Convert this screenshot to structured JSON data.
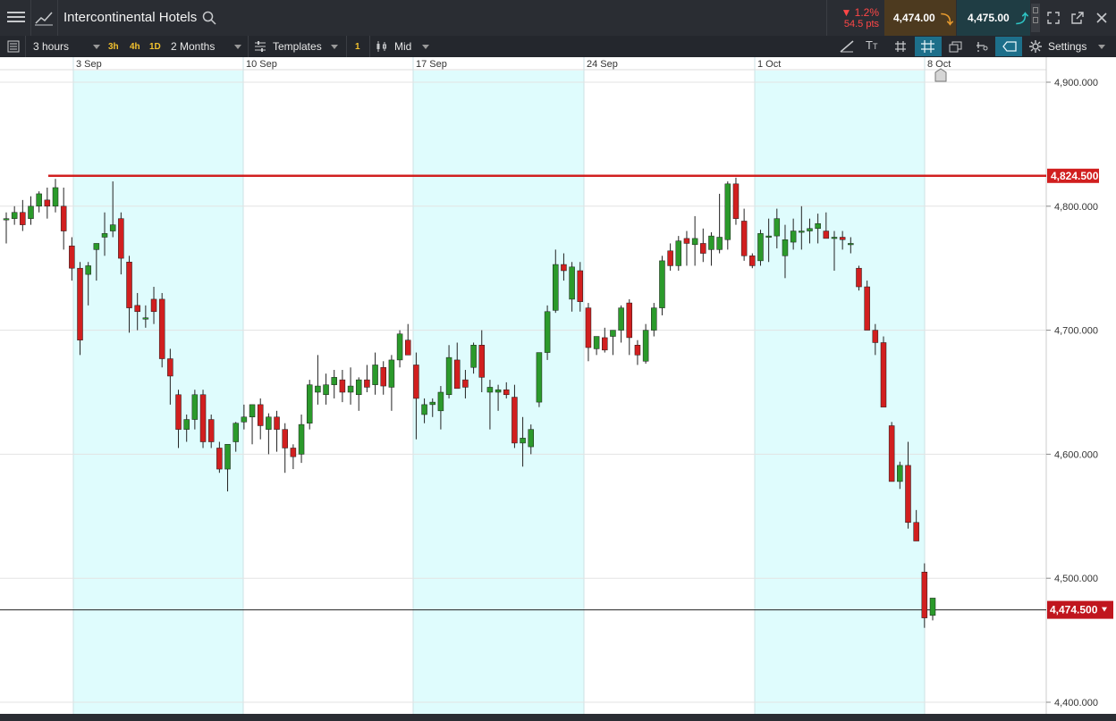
{
  "header": {
    "instrument": "Intercontinental Hotels",
    "change_percent": "▼ 1.2%",
    "change_points": "54.5 pts",
    "sell_price": "4,474.00",
    "buy_price": "4,475.00"
  },
  "toolbar": {
    "interval": "3 hours",
    "quick_intervals": [
      "3h",
      "4h",
      "1D"
    ],
    "range": "2 Months",
    "templates_label": "Templates",
    "count_badge": "1",
    "price_type": "Mid",
    "settings_label": "Settings"
  },
  "colors": {
    "up": "#2b9a2b",
    "down": "#d11f1f",
    "resistance": "#d11f1f",
    "current_price_bg": "#c0161e",
    "weekend_shade": "#dffcfd"
  },
  "chart_data": {
    "type": "candlestick",
    "x_labels": [
      "3 Sep",
      "10 Sep",
      "17 Sep",
      "24 Sep",
      "1 Oct",
      "8 Oct"
    ],
    "y_ticks": [
      "4,900.000",
      "4,800.000",
      "4,700.000",
      "4,600.000",
      "4,500.000",
      "4,400.000"
    ],
    "y_range": [
      4395,
      4910
    ],
    "resistance_label": "4,824.500",
    "resistance_value": 4824.5,
    "current_label": "4,474.500",
    "current_value": 4474.5,
    "candles": [
      [
        4790,
        4795,
        4770,
        4790
      ],
      [
        4790,
        4800,
        4785,
        4795
      ],
      [
        4795,
        4805,
        4780,
        4785
      ],
      [
        4790,
        4808,
        4785,
        4800
      ],
      [
        4800,
        4812,
        4795,
        4810
      ],
      [
        4805,
        4815,
        4790,
        4800
      ],
      [
        4800,
        4822,
        4795,
        4815
      ],
      [
        4800,
        4815,
        4765,
        4780
      ],
      [
        4768,
        4775,
        4740,
        4750
      ],
      [
        4750,
        4755,
        4680,
        4692
      ],
      [
        4745,
        4755,
        4720,
        4752
      ],
      [
        4765,
        4770,
        4740,
        4770
      ],
      [
        4775,
        4795,
        4760,
        4778
      ],
      [
        4780,
        4820,
        4775,
        4785
      ],
      [
        4790,
        4795,
        4745,
        4758
      ],
      [
        4755,
        4760,
        4698,
        4718
      ],
      [
        4720,
        4730,
        4700,
        4715
      ],
      [
        4710,
        4720,
        4702,
        4710
      ],
      [
        4725,
        4735,
        4705,
        4715
      ],
      [
        4725,
        4730,
        4670,
        4677
      ],
      [
        4677,
        4685,
        4640,
        4663
      ],
      [
        4648,
        4652,
        4605,
        4620
      ],
      [
        4620,
        4632,
        4610,
        4628
      ],
      [
        4628,
        4652,
        4620,
        4648
      ],
      [
        4648,
        4652,
        4605,
        4610
      ],
      [
        4628,
        4632,
        4605,
        4610
      ],
      [
        4605,
        4610,
        4585,
        4588
      ],
      [
        4588,
        4605,
        4570,
        4608
      ],
      [
        4610,
        4626,
        4602,
        4625
      ],
      [
        4626,
        4640,
        4620,
        4630
      ],
      [
        4630,
        4640,
        4608,
        4640
      ],
      [
        4640,
        4645,
        4612,
        4623
      ],
      [
        4620,
        4633,
        4600,
        4630
      ],
      [
        4630,
        4635,
        4602,
        4620
      ],
      [
        4620,
        4625,
        4585,
        4605
      ],
      [
        4605,
        4608,
        4588,
        4598
      ],
      [
        4600,
        4632,
        4593,
        4624
      ],
      [
        4625,
        4660,
        4620,
        4656
      ],
      [
        4650,
        4680,
        4640,
        4655
      ],
      [
        4648,
        4665,
        4640,
        4656
      ],
      [
        4656,
        4668,
        4645,
        4662
      ],
      [
        4660,
        4668,
        4642,
        4650
      ],
      [
        4650,
        4670,
        4640,
        4655
      ],
      [
        4648,
        4662,
        4635,
        4660
      ],
      [
        4660,
        4672,
        4650,
        4654
      ],
      [
        4656,
        4682,
        4648,
        4672
      ],
      [
        4670,
        4675,
        4648,
        4655
      ],
      [
        4654,
        4680,
        4635,
        4676
      ],
      [
        4676,
        4700,
        4670,
        4697
      ],
      [
        4692,
        4705,
        4680,
        4680
      ],
      [
        4672,
        4682,
        4612,
        4645
      ],
      [
        4632,
        4645,
        4625,
        4640
      ],
      [
        4640,
        4645,
        4630,
        4642
      ],
      [
        4635,
        4655,
        4620,
        4650
      ],
      [
        4648,
        4688,
        4645,
        4678
      ],
      [
        4676,
        4690,
        4655,
        4653
      ],
      [
        4660,
        4668,
        4645,
        4654
      ],
      [
        4670,
        4690,
        4665,
        4688
      ],
      [
        4688,
        4700,
        4650,
        4662
      ],
      [
        4650,
        4660,
        4620,
        4654
      ],
      [
        4650,
        4656,
        4635,
        4652
      ],
      [
        4652,
        4658,
        4645,
        4648
      ],
      [
        4646,
        4656,
        4605,
        4609
      ],
      [
        4609,
        4630,
        4590,
        4613
      ],
      [
        4606,
        4624,
        4600,
        4620
      ],
      [
        4642,
        4682,
        4638,
        4682
      ],
      [
        4682,
        4720,
        4676,
        4715
      ],
      [
        4716,
        4765,
        4714,
        4753
      ],
      [
        4753,
        4762,
        4740,
        4748
      ],
      [
        4725,
        4755,
        4715,
        4751
      ],
      [
        4748,
        4755,
        4715,
        4723
      ],
      [
        4718,
        4722,
        4675,
        4686
      ],
      [
        4685,
        4695,
        4680,
        4695
      ],
      [
        4694,
        4702,
        4682,
        4684
      ],
      [
        4695,
        4700,
        4680,
        4700
      ],
      [
        4700,
        4720,
        4690,
        4718
      ],
      [
        4722,
        4725,
        4680,
        4694
      ],
      [
        4688,
        4692,
        4672,
        4680
      ],
      [
        4675,
        4705,
        4673,
        4700
      ],
      [
        4700,
        4722,
        4695,
        4718
      ],
      [
        4718,
        4760,
        4712,
        4756
      ],
      [
        4764,
        4770,
        4748,
        4752
      ],
      [
        4752,
        4776,
        4748,
        4772
      ],
      [
        4774,
        4780,
        4752,
        4770
      ],
      [
        4769,
        4792,
        4752,
        4774
      ],
      [
        4770,
        4782,
        4755,
        4762
      ],
      [
        4765,
        4779,
        4752,
        4776
      ],
      [
        4765,
        4810,
        4762,
        4775
      ],
      [
        4773,
        4820,
        4765,
        4818
      ],
      [
        4818,
        4823,
        4785,
        4790
      ],
      [
        4788,
        4798,
        4756,
        4760
      ],
      [
        4760,
        4762,
        4750,
        4752
      ],
      [
        4756,
        4781,
        4752,
        4778
      ],
      [
        4775,
        4790,
        4755,
        4776
      ],
      [
        4776,
        4798,
        4766,
        4790
      ],
      [
        4760,
        4785,
        4742,
        4773
      ],
      [
        4771,
        4790,
        4765,
        4780
      ],
      [
        4780,
        4800,
        4765,
        4780
      ],
      [
        4780,
        4790,
        4770,
        4782
      ],
      [
        4782,
        4794,
        4770,
        4786
      ],
      [
        4780,
        4795,
        4775,
        4774
      ],
      [
        4774,
        4780,
        4748,
        4775
      ],
      [
        4775,
        4780,
        4765,
        4773
      ],
      [
        4770,
        4775,
        4762,
        4770
      ],
      [
        4750,
        4752,
        4732,
        4735
      ],
      [
        4735,
        4740,
        4715,
        4700
      ],
      [
        4700,
        4705,
        4680,
        4690
      ],
      [
        4690,
        4695,
        4650,
        4638
      ],
      [
        4623,
        4626,
        4578,
        4578
      ],
      [
        4578,
        4594,
        4572,
        4591
      ],
      [
        4591,
        4610,
        4540,
        4545
      ],
      [
        4545,
        4555,
        4530,
        4530
      ],
      [
        4505,
        4512,
        4460,
        4468
      ],
      [
        4470,
        4482,
        4466,
        4484
      ]
    ]
  }
}
